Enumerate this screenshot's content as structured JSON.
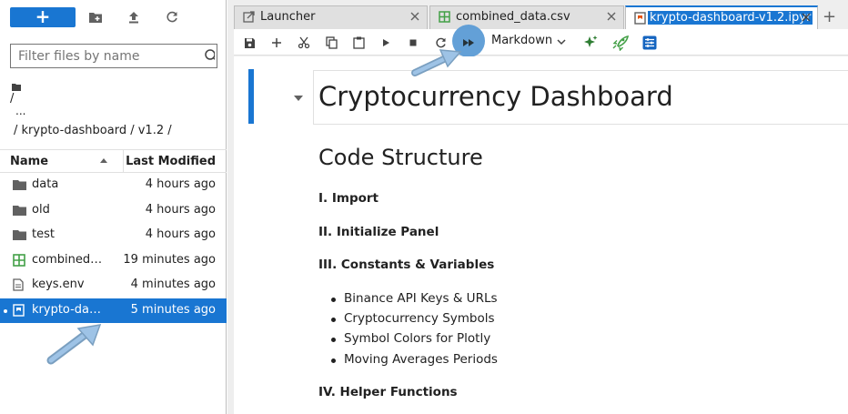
{
  "colors": {
    "accent": "#1976d2",
    "selected_row": "#1976d2",
    "highlight": "#5b9bd5",
    "green_icon": "#43a047"
  },
  "sidebar": {
    "toolbar": {
      "new_button_label": "+",
      "icons": [
        "new-folder-icon",
        "upload-icon",
        "refresh-icon"
      ]
    },
    "filter": {
      "placeholder": "Filter files by name"
    },
    "breadcrumb": {
      "root": "/",
      "dots": "...",
      "path": "/ krypto-dashboard / v1.2 /"
    },
    "columns": {
      "name": "Name",
      "modified": "Last Modified"
    },
    "files": [
      {
        "name": "data",
        "modified": "4 hours ago",
        "icon": "folder-icon"
      },
      {
        "name": "old",
        "modified": "4 hours ago",
        "icon": "folder-icon"
      },
      {
        "name": "test",
        "modified": "4 hours ago",
        "icon": "folder-icon"
      },
      {
        "name": "combined…",
        "modified": "19 minutes ago",
        "icon": "spreadsheet-icon"
      },
      {
        "name": "keys.env",
        "modified": "4 minutes ago",
        "icon": "file-icon"
      },
      {
        "name": "krypto-das…",
        "modified": "5 minutes ago",
        "icon": "notebook-icon",
        "selected": true
      }
    ]
  },
  "tabs": [
    {
      "label": "Launcher",
      "icon": "launcher-icon"
    },
    {
      "label": "combined_data.csv",
      "icon": "spreadsheet-icon"
    },
    {
      "label": "krypto-dashboard-v1.2.ipyr",
      "icon": "notebook-icon",
      "active": true
    }
  ],
  "notebook_toolbar": {
    "icons": [
      "save-icon",
      "add-cell-icon",
      "cut-icon",
      "copy-icon",
      "paste-icon",
      "run-icon",
      "stop-icon",
      "restart-icon",
      "run-all-icon"
    ],
    "cell_type": "Markdown",
    "extra_icons": [
      "sparkle-icon",
      "rocket-icon",
      "settings-sliders-icon"
    ]
  },
  "notebook": {
    "title": "Cryptocurrency Dashboard",
    "section_heading": "Code Structure",
    "items": {
      "i1": "I. Import",
      "i2": "II. Initialize Panel",
      "i3": "III. Constants & Variables",
      "i4": "IV. Helper Functions"
    },
    "bullets": [
      "Binance API Keys & URLs",
      "Cryptocurrency Symbols",
      "Symbol Colors for Plotly",
      "Moving Averages Periods"
    ]
  }
}
